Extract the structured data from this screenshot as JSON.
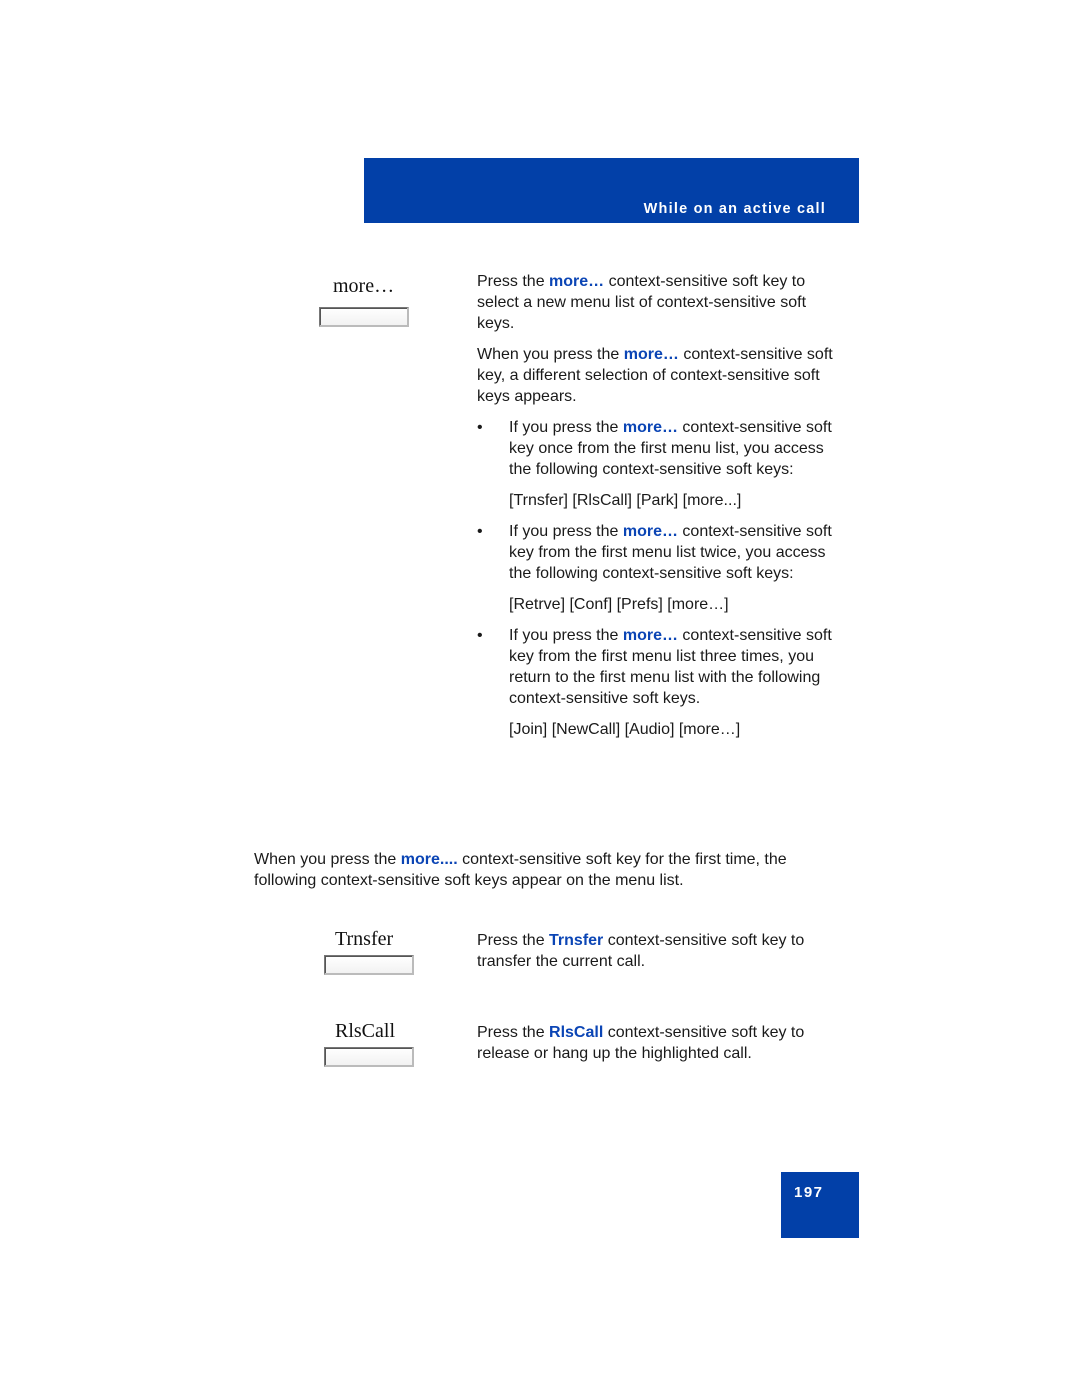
{
  "header": {
    "title": "While on an active call"
  },
  "colors": {
    "brand_blue": "#0240a8",
    "highlight_blue": "#0b45b5"
  },
  "more_section": {
    "key_label": "more…",
    "para1": {
      "pre": "Press the ",
      "hl": "more…",
      "post": " context-sensitive soft key to select a new menu list of context-sensitive soft keys."
    },
    "para2": {
      "pre": "When you press the ",
      "hl": "more…",
      "post": " context-sensitive soft key, a different selection of context-sensitive soft keys appears."
    },
    "bullets": [
      {
        "pre": "If you press the ",
        "hl": "more…",
        "post": " context-sensitive soft key once from the first menu list, you access the following context-sensitive soft keys:",
        "keys": "[Trnsfer] [RlsCall] [Park] [more...]"
      },
      {
        "pre": "If you press the ",
        "hl": "more…",
        "post": " context-sensitive soft key from the first menu list twice, you access the following context-sensitive soft keys:",
        "keys": "[Retrve] [Conf] [Prefs] [more…]"
      },
      {
        "pre": "If you press the ",
        "hl": "more…",
        "post": " context-sensitive soft key from the first menu list three times, you return to the first menu list with the following context-sensitive soft keys.",
        "keys": "[Join] [NewCall] [Audio] [more…]"
      }
    ],
    "bullet_char": "•"
  },
  "intro": {
    "pre": "When you press the ",
    "hl": "more....",
    "post": " context-sensitive soft key for the first time, the following context-sensitive soft keys appear on the menu list."
  },
  "trnsfer": {
    "key_label": "Trnsfer",
    "pre": "Press the ",
    "hl": "Trnsfer",
    "post": " context-sensitive soft key to transfer the current call."
  },
  "rlscall": {
    "key_label": "RlsCall",
    "pre": "Press the ",
    "hl": "RlsCall",
    "post": " context-sensitive soft key to release or hang up the highlighted call."
  },
  "page_number": "197"
}
